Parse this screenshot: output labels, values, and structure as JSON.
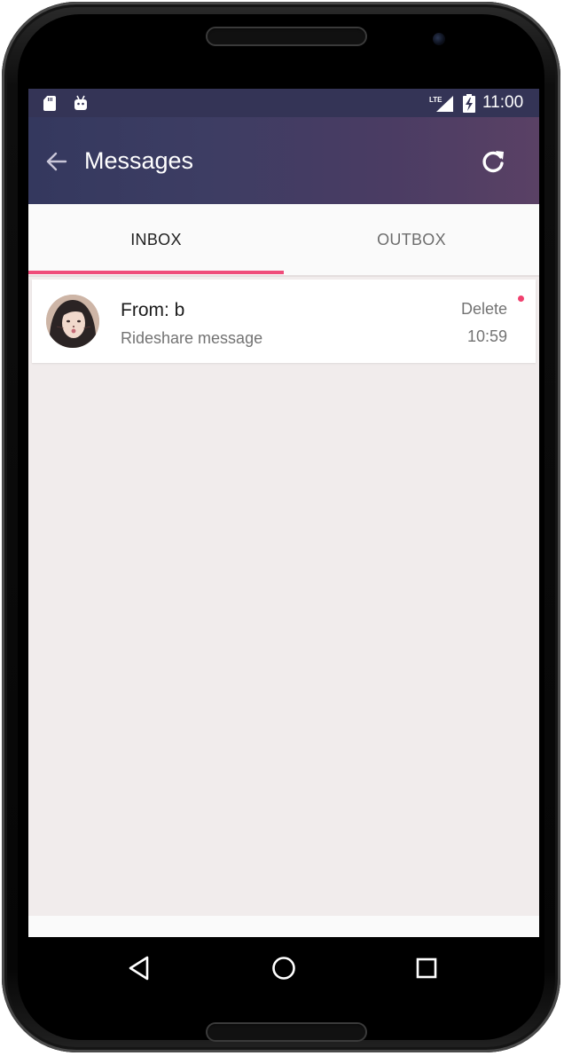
{
  "status_bar": {
    "time": "11:00",
    "network_label": "LTE",
    "icons": [
      "sd-card-icon",
      "android-debug-icon",
      "lte-signal-icon",
      "battery-charging-icon"
    ]
  },
  "app_bar": {
    "title": "Messages",
    "back_icon": "arrow-left-icon",
    "refresh_icon": "refresh-icon",
    "gradient": [
      "#34385e",
      "#5a4165"
    ]
  },
  "tabs": [
    {
      "label": "INBOX",
      "selected": true
    },
    {
      "label": "OUTBOX",
      "selected": false
    }
  ],
  "accent_color": "#ef4c7a",
  "messages": [
    {
      "from": "From: b",
      "subject": "Rideshare message",
      "action_label": "Delete",
      "time": "10:59",
      "unread": true
    }
  ],
  "nav_bar": {
    "buttons": [
      "back-triangle-icon",
      "home-circle-icon",
      "recents-square-icon"
    ]
  }
}
